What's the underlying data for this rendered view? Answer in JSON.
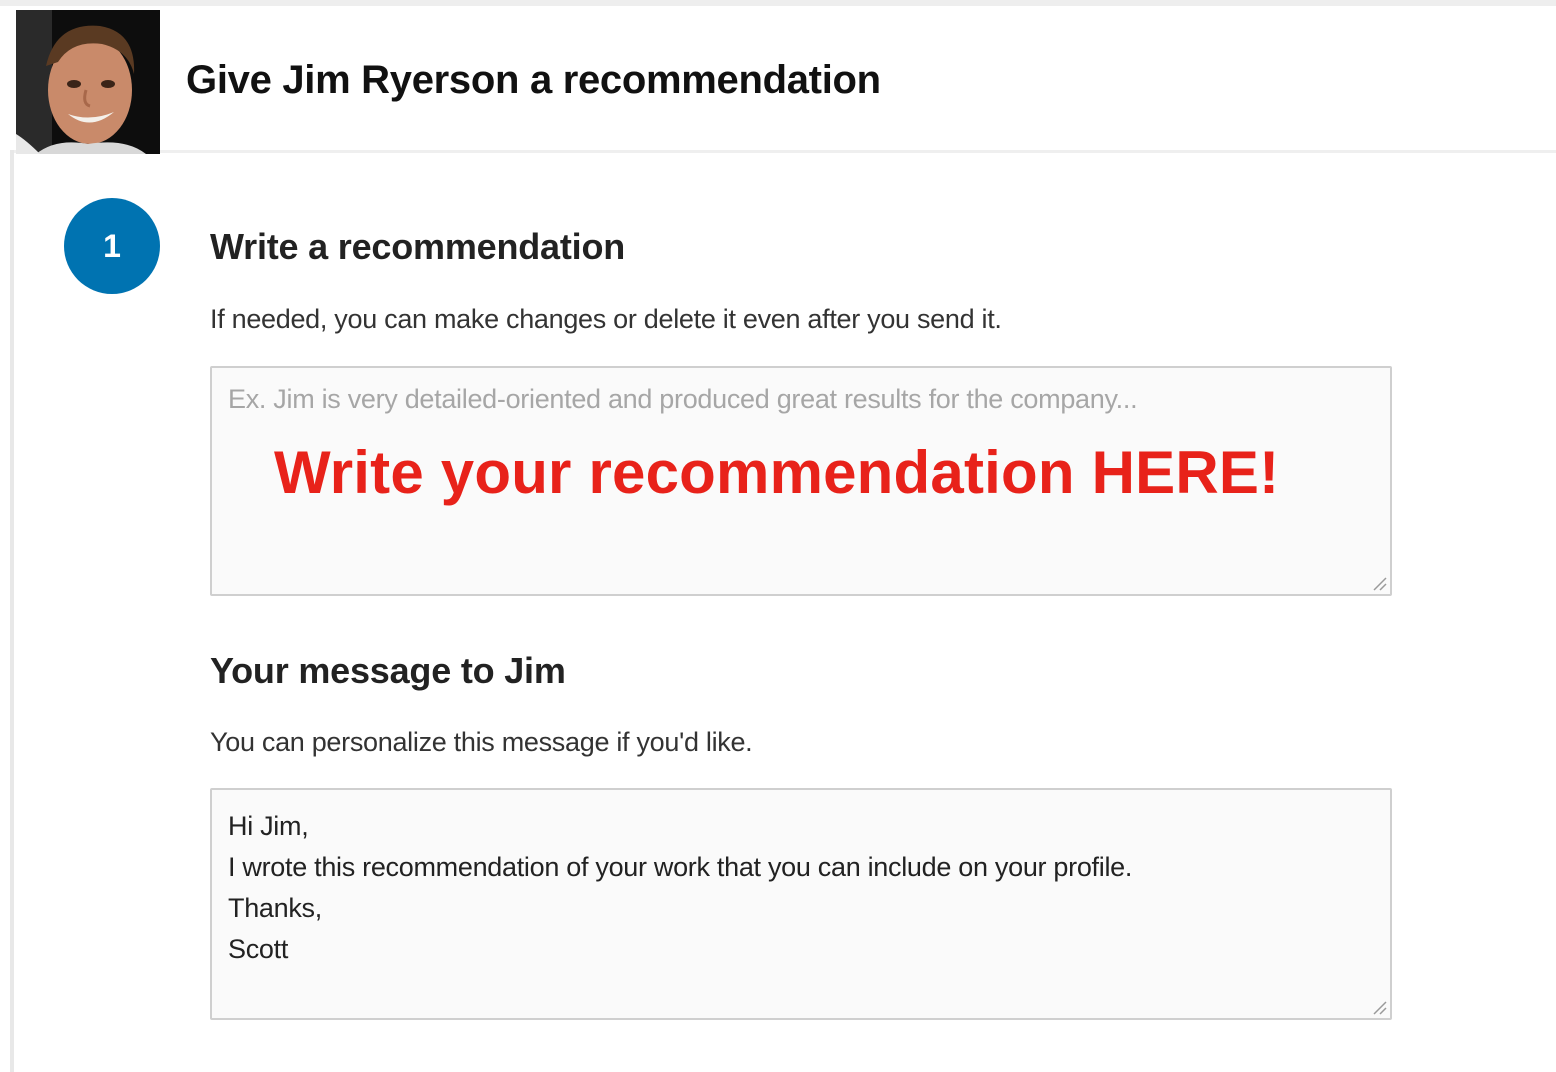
{
  "header": {
    "title": "Give Jim Ryerson a recommendation",
    "avatar_icon": "person-photo"
  },
  "step": {
    "number": "1",
    "color": "#0073b1"
  },
  "recommendation": {
    "heading": "Write a recommendation",
    "helper": "If needed, you can make changes or delete it even after you send it.",
    "placeholder": "Ex. Jim is very detailed-oriented and produced great results for the company...",
    "callout": "Write your recommendation HERE!",
    "callout_color": "#e8221a"
  },
  "message": {
    "heading": "Your message to Jim",
    "helper": "You can personalize this message if you'd like.",
    "lines": [
      "Hi Jim,",
      "I wrote this recommendation of your work that you can include on your profile.",
      "Thanks,",
      "Scott"
    ]
  }
}
